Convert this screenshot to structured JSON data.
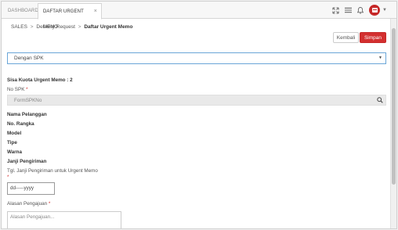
{
  "tabs": [
    {
      "label": "DASHBOARD"
    },
    {
      "label": "DAFTAR URGENT MEMO",
      "close": "×"
    }
  ],
  "header_icons": [
    "expand-icon",
    "menu-icon",
    "bell-icon",
    "user-avatar",
    "chevron-down-icon"
  ],
  "colors": {
    "accent": "#d32f2f",
    "select_border": "#6aa6d8",
    "input_bg": "#e9e9e9"
  },
  "breadcrumb": {
    "items": [
      "SALES",
      "Delivery Request",
      "Daftar Urgent Memo"
    ],
    "separator": ">"
  },
  "toolbar": {
    "kembali_label": "Kembali",
    "simpan_label": "Simpan"
  },
  "spk_select": {
    "value": "Dengan SPK"
  },
  "form": {
    "quota": "Sisa Kuota Urgent Memo : 2",
    "no_spk_label": "No SPK",
    "no_spk_placeholder": "FormSPKNo",
    "nama_pelanggan": "Nama Pelanggan",
    "no_rangka": "No. Rangka",
    "model": "Model",
    "tipe": "Tipe",
    "warna": "Warna",
    "janji_pengiriman": "Janji Pengiriman",
    "tgl_label": "Tgl. Janji Pengiriman untuk Urgent Memo",
    "date_value": "dd-----yyyy",
    "alasan_label": "Alasan Pengajuan",
    "alasan_placeholder": "Alasan Pengajuan...",
    "required_mark": "*"
  }
}
